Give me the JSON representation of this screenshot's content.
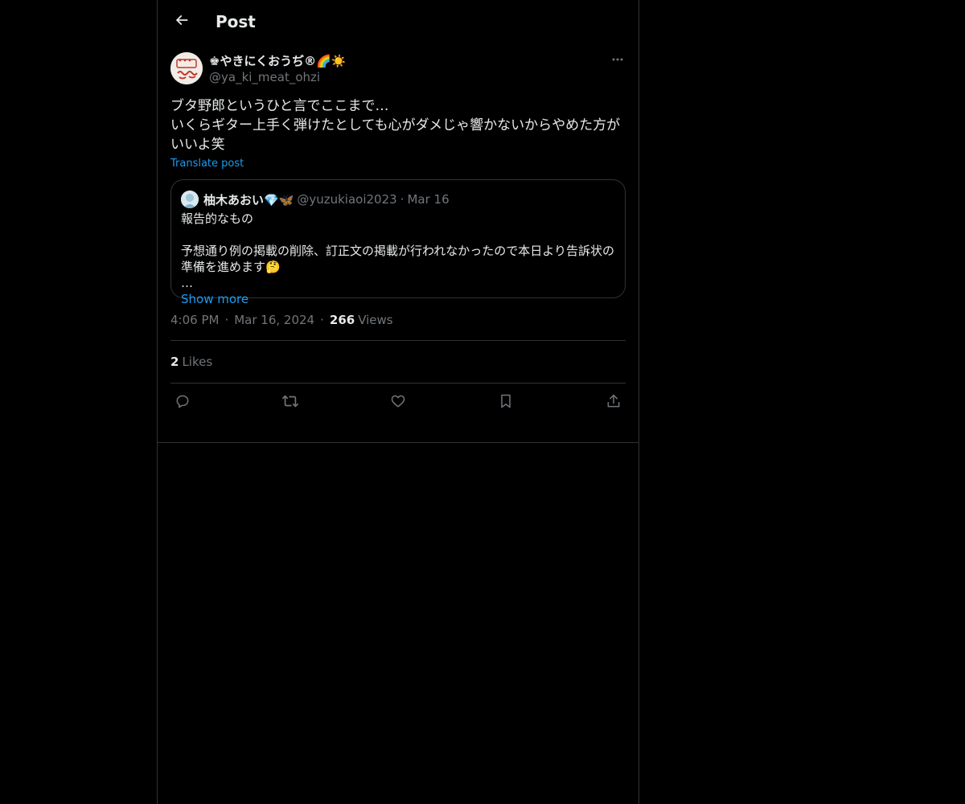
{
  "header": {
    "title": "Post",
    "back_icon": "arrow-left-icon"
  },
  "post": {
    "author": {
      "display_name": "♚やきにくおうぢ®🌈☀️",
      "handle": "@ya_ki_meat_ohzi"
    },
    "more_icon": "more-horizontal-icon",
    "text": "ブタ野郎というひと言でここまで…\nいくらギター上手く弾けたとしても心がダメじゃ響かないからやめた方がいいよ笑",
    "translate_label": "Translate post",
    "quote": {
      "display_name": "柚木あおい💎🦋",
      "handle": "@yuzukiaoi2023",
      "separator": "·",
      "date": "Mar 16",
      "text": "報告的なもの\n\n予想通り例の掲載の削除、訂正文の掲載が行われなかったので本日より告訴状の準備を進めます🤔\n…",
      "show_more_label": "Show more"
    },
    "meta": {
      "time": "4:06 PM",
      "separator": "·",
      "date": "Mar 16, 2024",
      "views_count": "266",
      "views_label": "Views"
    },
    "likes": {
      "count": "2",
      "label": "Likes"
    },
    "actions": [
      {
        "name": "reply",
        "icon": "reply-icon"
      },
      {
        "name": "repost",
        "icon": "repost-icon"
      },
      {
        "name": "like",
        "icon": "heart-icon"
      },
      {
        "name": "bookmark",
        "icon": "bookmark-icon"
      },
      {
        "name": "share",
        "icon": "share-icon"
      }
    ]
  },
  "colors": {
    "background": "#000000",
    "text": "#e7e9ea",
    "secondary": "#71767b",
    "accent": "#1d9bf0",
    "border": "#2f3336"
  }
}
